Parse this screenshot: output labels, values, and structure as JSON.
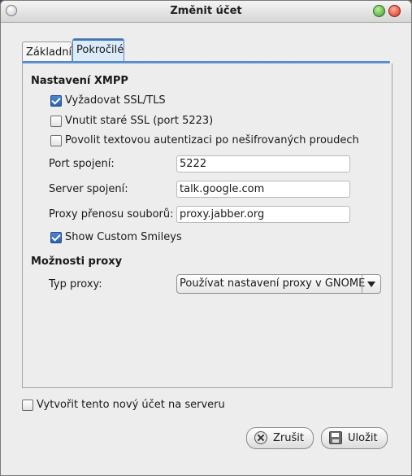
{
  "window": {
    "title": "Změnit účet"
  },
  "tabs": [
    {
      "label": "Základní",
      "active": false
    },
    {
      "label": "Pokročilé",
      "active": true
    }
  ],
  "xmpp": {
    "heading": "Nastavení XMPP",
    "checkboxes": [
      {
        "label": "Vyžadovat SSL/TLS",
        "checked": true
      },
      {
        "label": "Vnutit staré SSL (port 5223)",
        "checked": false
      },
      {
        "label": "Povolit textovou autentizaci po nešifrovaných proudech",
        "checked": false
      }
    ],
    "fields": [
      {
        "label": "Port spojení:",
        "value": "5222"
      },
      {
        "label": "Server spojení:",
        "value": "talk.google.com"
      },
      {
        "label": "Proxy přenosu souborů:",
        "value": "proxy.jabber.org"
      }
    ],
    "smileys": {
      "label": "Show Custom Smileys",
      "checked": true
    }
  },
  "proxy": {
    "heading": "Možnosti proxy",
    "type_label": "Typ proxy:",
    "type_value": "Používat nastavení proxy v GNOME"
  },
  "create_account": {
    "label": "Vytvořit tento nový účet na serveru",
    "checked": false
  },
  "buttons": {
    "cancel": "Zrušit",
    "save": "Uložit"
  },
  "colors": {
    "accent": "#3e73b6",
    "check": "#2c61b0"
  }
}
